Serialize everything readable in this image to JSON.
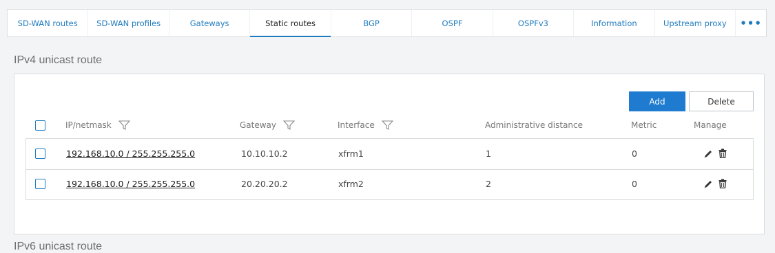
{
  "tabs": [
    {
      "label": "SD-WAN routes"
    },
    {
      "label": "SD-WAN profiles"
    },
    {
      "label": "Gateways"
    },
    {
      "label": "Static routes"
    },
    {
      "label": "BGP"
    },
    {
      "label": "OSPF"
    },
    {
      "label": "OSPFv3"
    },
    {
      "label": "Information"
    },
    {
      "label": "Upstream proxy"
    },
    {
      "label": "•••"
    }
  ],
  "active_tab": "Static routes",
  "section_title": "IPv4 unicast route",
  "section_title_next": "IPv6 unicast route",
  "buttons": {
    "add": "Add",
    "delete": "Delete"
  },
  "columns": {
    "ip": "IP/netmask",
    "gateway": "Gateway",
    "interface": "Interface",
    "distance": "Administrative distance",
    "metric": "Metric",
    "manage": "Manage"
  },
  "rows": [
    {
      "ip": "192.168.10.0 / 255.255.255.0",
      "gateway": "10.10.10.2",
      "interface": "xfrm1",
      "distance": "1",
      "metric": "0"
    },
    {
      "ip": "192.168.10.0 / 255.255.255.0",
      "gateway": "20.20.20.2",
      "interface": "xfrm2",
      "distance": "2",
      "metric": "0"
    }
  ],
  "colors": {
    "accent": "#1f7bcf",
    "link": "#1f7bbf"
  },
  "icons": {
    "filter": "filter-icon",
    "edit": "pencil-icon",
    "delete": "trash-icon",
    "more": "more-icon"
  }
}
